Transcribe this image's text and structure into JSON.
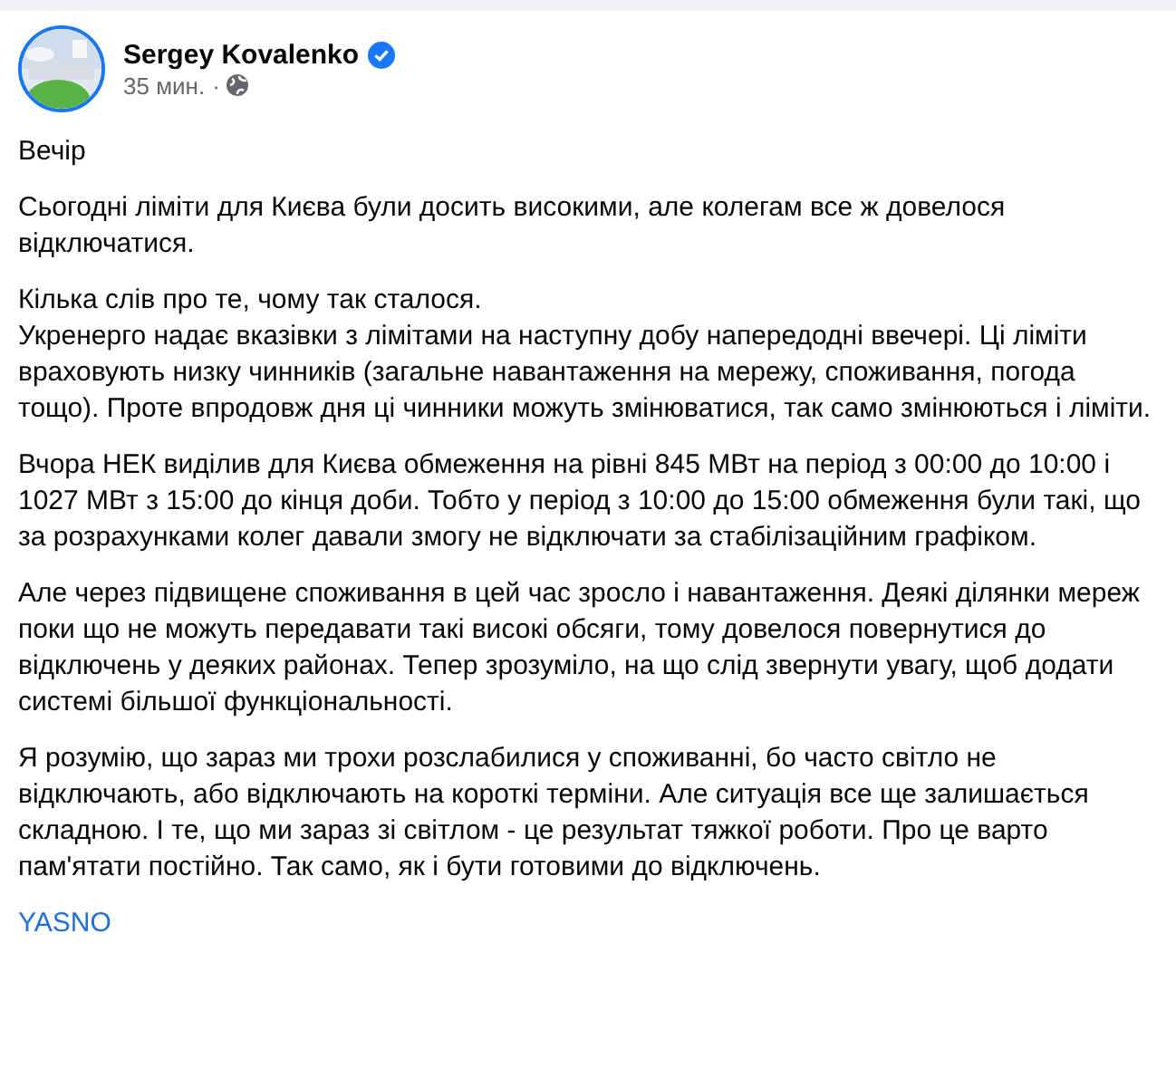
{
  "author": {
    "name": "Sergey Kovalenko",
    "verified": true,
    "time": "35 мин.",
    "separator": "·"
  },
  "paragraphs": [
    [
      "Вечір"
    ],
    [
      "Сьогодні ліміти для Києва були досить високими, але колегам все ж довелося відключатися."
    ],
    [
      "Кілька слів про те, чому так сталося.",
      "Укренерго надає вказівки з лімітами на наступну добу напередодні ввечері. Ці ліміти враховують низку чинників (загальне навантаження на мережу, споживання, погода тощо). Проте впродовж дня ці чинники можуть змінюватися, так само змінюються і ліміти."
    ],
    [
      "Вчора НЕК виділив для Києва обмеження на рівні 845 МВт на період з 00:00 до 10:00 і 1027 МВт з 15:00 до кінця доби. Тобто у період з 10:00 до 15:00 обмеження були такі, що за розрахунками колег давали змогу не відключати за стабілізаційним графіком."
    ],
    [
      "Але через підвищене споживання в цей час зросло і навантаження. Деякі ділянки мереж поки що не можуть передавати такі високі обсяги, тому довелося повернутися до відключень у деяких районах. Тепер зрозуміло, на що слід звернути увагу, щоб додати системі більшої функціональності."
    ],
    [
      "Я розумію, що зараз ми трохи розслабилися у споживанні, бо часто світло не відключають, або відключають на короткі терміни. Але ситуація все ще залишається складною. І те, що ми зараз зі світлом - це результат тяжкої роботи. Про це варто пам'ятати постійно. Так само, як і бути готовими до відключень."
    ]
  ],
  "link": "YASNO"
}
